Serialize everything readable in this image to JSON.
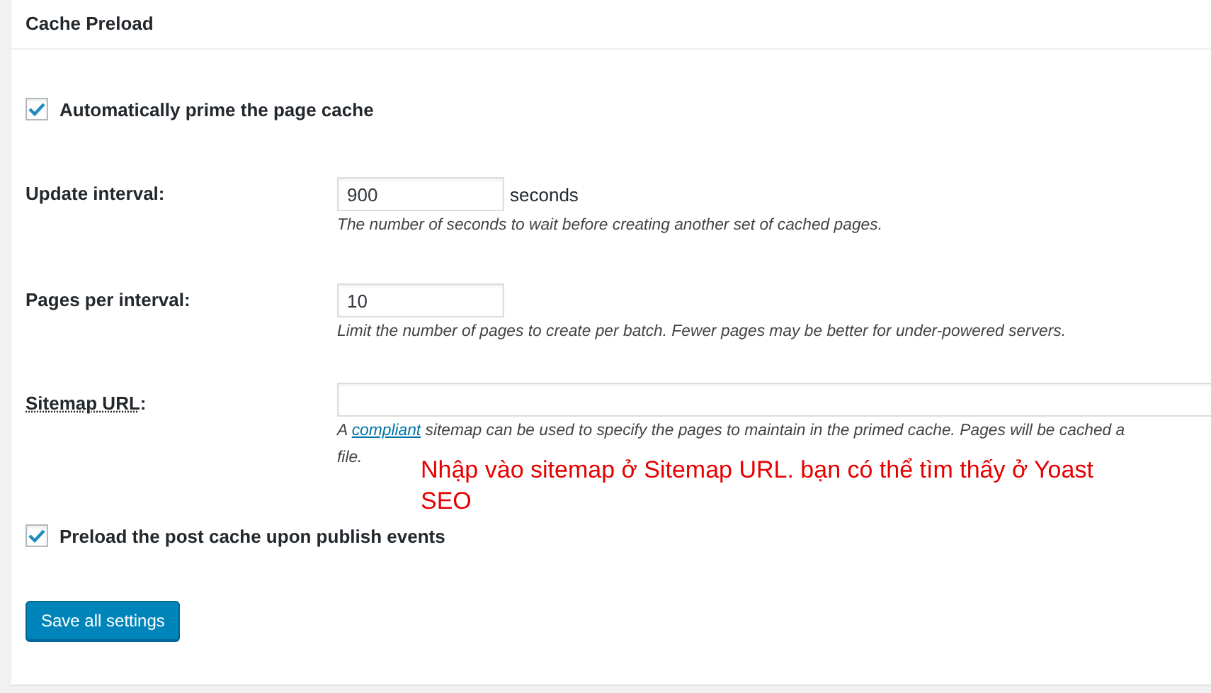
{
  "panel": {
    "title": "Cache Preload"
  },
  "prime_option": {
    "label": "Automatically prime the page cache",
    "checked": true
  },
  "fields": [
    {
      "label": "Update interval:",
      "value": "900",
      "unit": "seconds",
      "description": "The number of seconds to wait before creating another set of cached pages."
    },
    {
      "label": "Pages per interval:",
      "value": "10",
      "description": "Limit the number of pages to create per batch. Fewer pages may be better for under-powered servers."
    }
  ],
  "sitemap": {
    "label": "Sitemap URL",
    "label_suffix": ":",
    "description_before": "A ",
    "link": "compliant",
    "description_after": " sitemap can be used to specify the pages to maintain in the primed cache. Pages will be cached a",
    "description_continued": "file."
  },
  "annotation": "Nhập vào sitemap ở Sitemap URL. bạn có thể tìm thấy ở Yoast SEO",
  "post_option": {
    "label": "Preload the post cache upon publish events",
    "checked": true
  },
  "save_button": "Save all settings"
}
